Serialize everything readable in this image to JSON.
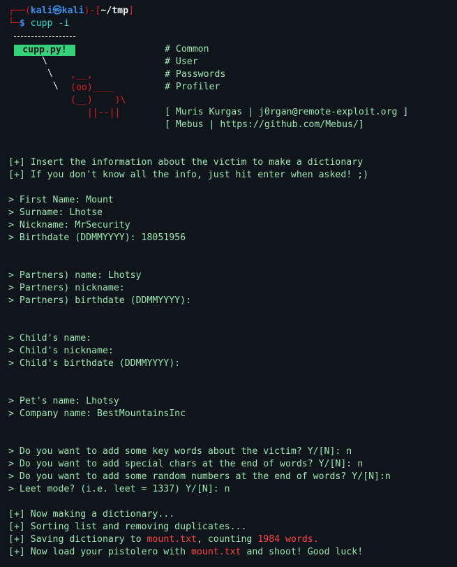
{
  "prompt": {
    "bracket_open": "┌──(",
    "user": "kali㉿kali",
    "mid": ")-[",
    "path": "~/tmp",
    "bracket_close": "]",
    "second_prefix": "└─",
    "dollar": "$",
    "command": "cupp",
    "arg": "-i"
  },
  "banner": {
    "title": "cupp.py!",
    "comments": [
      "# Common",
      "# User",
      "# Passwords",
      "# Profiler"
    ],
    "author_line": "[ Muris Kurgas | j0rgan@remote-exploit.org ]",
    "mebus_line": "[ Mebus | https://github.com/Mebus/]",
    "ascii_white": [
      "\\",
      " \\",
      "  \\"
    ],
    "ascii_red": [
      ",__,",
      "(oo)____",
      "(__)    )\\",
      "   ||--||"
    ]
  },
  "intro": [
    "[+] Insert the information about the victim to make a dictionary",
    "[+] If you don't know all the info, just hit enter when asked! ;)"
  ],
  "victim": [
    "> First Name: Mount",
    "> Surname: Lhotse",
    "> Nickname: MrSecurity",
    "> Birthdate (DDMMYYYY): 18051956"
  ],
  "partner": [
    "> Partners) name: Lhotsy",
    "> Partners) nickname:",
    "> Partners) birthdate (DDMMYYYY):"
  ],
  "child": [
    "> Child's name:",
    "> Child's nickname:",
    "> Child's birthdate (DDMMYYYY):"
  ],
  "pet": [
    "> Pet's name: Lhotsy",
    "> Company name: BestMountainsInc"
  ],
  "questions": [
    "> Do you want to add some key words about the victim? Y/[N]: n",
    "> Do you want to add special chars at the end of words? Y/[N]: n",
    "> Do you want to add some random numbers at the end of words? Y/[N]:n",
    "> Leet mode? (i.e. leet = 1337) Y/[N]: n"
  ],
  "output": {
    "making": "[+] Now making a dictionary...",
    "sorting": "[+] Sorting list and removing duplicates...",
    "saving_prefix": "[+] Saving dictionary to ",
    "filename": "mount.txt",
    "saving_mid": ", counting ",
    "count": "1984 words.",
    "load_prefix": "[+] Now load your pistolero with ",
    "load_file": "mount.txt",
    "load_suffix": " and shoot! Good luck!"
  },
  "colors": {
    "background": "#10151c",
    "prompt_red": "#e01b24",
    "prompt_blue": "#3b8eea",
    "banner_green": "#34d27a",
    "text_green": "#9ae6b4"
  }
}
